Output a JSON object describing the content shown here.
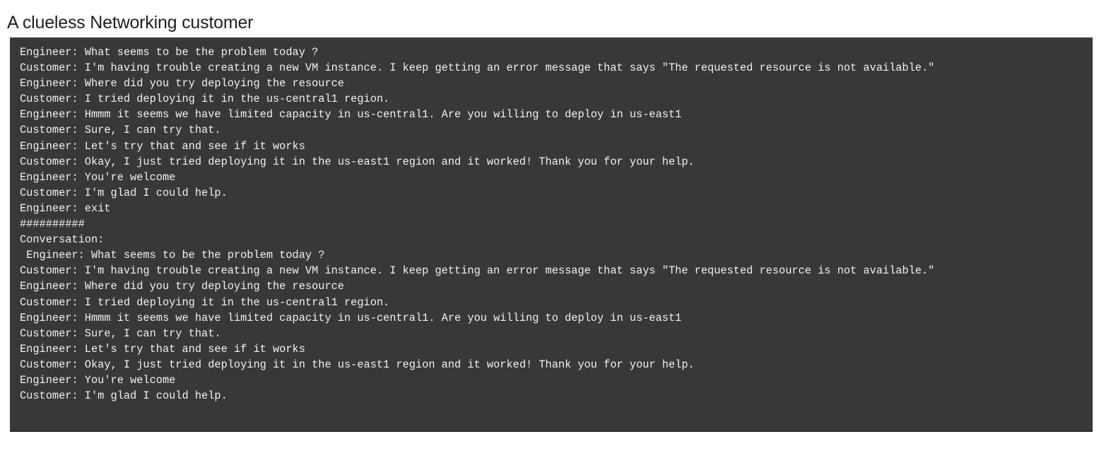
{
  "page": {
    "title": "A clueless Networking customer"
  },
  "output": {
    "lines": [
      "Engineer: What seems to be the problem today ?",
      "Customer: I'm having trouble creating a new VM instance. I keep getting an error message that says \"The requested resource is not available.\"",
      "Engineer: Where did you try deploying the resource",
      "Customer: I tried deploying it in the us-central1 region.",
      "Engineer: Hmmm it seems we have limited capacity in us-central1. Are you willing to deploy in us-east1",
      "Customer: Sure, I can try that.",
      "Engineer: Let's try that and see if it works",
      "Customer: Okay, I just tried deploying it in the us-east1 region and it worked! Thank you for your help.",
      "Engineer: You're welcome",
      "Customer: I'm glad I could help.",
      "Engineer: exit",
      "##########",
      "Conversation:",
      " Engineer: What seems to be the problem today ?",
      "Customer: I'm having trouble creating a new VM instance. I keep getting an error message that says \"The requested resource is not available.\"",
      "Engineer: Where did you try deploying the resource",
      "Customer: I tried deploying it in the us-central1 region.",
      "Engineer: Hmmm it seems we have limited capacity in us-central1. Are you willing to deploy in us-east1",
      "Customer: Sure, I can try that.",
      "Engineer: Let's try that and see if it works",
      "Customer: Okay, I just tried deploying it in the us-east1 region and it worked! Thank you for your help.",
      "Engineer: You're welcome",
      "Customer: I'm glad I could help."
    ]
  },
  "colors": {
    "page_background": "#ffffff",
    "output_background": "#383838",
    "output_text": "#f1f1f1",
    "title_text": "#1f1f1f"
  }
}
